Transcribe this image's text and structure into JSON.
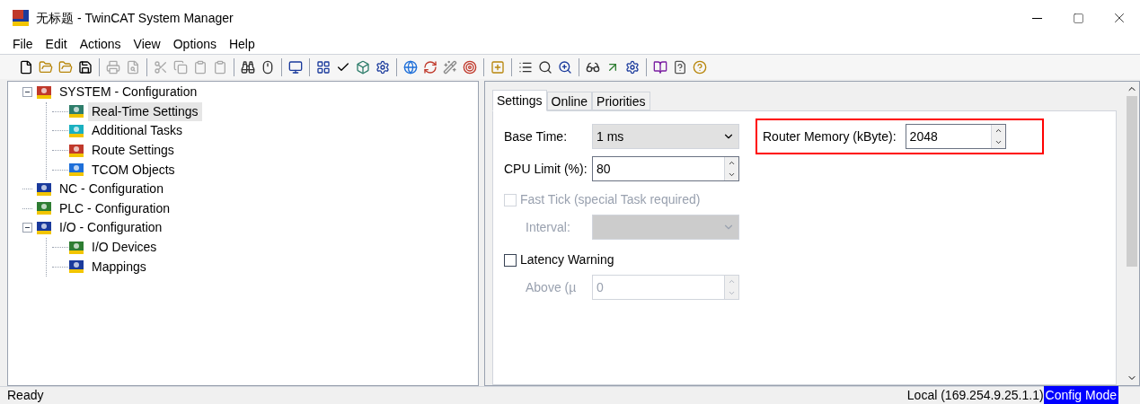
{
  "window": {
    "title": "无标题 - TwinCAT System Manager"
  },
  "menu": [
    "File",
    "Edit",
    "Actions",
    "View",
    "Options",
    "Help"
  ],
  "toolbar": [
    {
      "kind": "new",
      "disabled": false
    },
    {
      "kind": "open",
      "disabled": false
    },
    {
      "kind": "open",
      "disabled": false
    },
    {
      "kind": "save",
      "disabled": false
    },
    {
      "kind": "sep"
    },
    {
      "kind": "print",
      "disabled": true
    },
    {
      "kind": "preview",
      "disabled": true
    },
    {
      "kind": "sep"
    },
    {
      "kind": "cut",
      "disabled": true
    },
    {
      "kind": "copy",
      "disabled": true
    },
    {
      "kind": "paste",
      "disabled": true
    },
    {
      "kind": "paste",
      "disabled": true
    },
    {
      "kind": "sep"
    },
    {
      "kind": "find",
      "disabled": false
    },
    {
      "kind": "mouse",
      "disabled": false
    },
    {
      "kind": "sep"
    },
    {
      "kind": "monitor",
      "disabled": false
    },
    {
      "kind": "sep"
    },
    {
      "kind": "grid",
      "disabled": false
    },
    {
      "kind": "check",
      "disabled": false
    },
    {
      "kind": "cube",
      "disabled": false
    },
    {
      "kind": "gear",
      "disabled": false
    },
    {
      "kind": "sep"
    },
    {
      "kind": "globe",
      "disabled": false
    },
    {
      "kind": "refresh",
      "disabled": false
    },
    {
      "kind": "wand",
      "disabled": false
    },
    {
      "kind": "target",
      "disabled": false
    },
    {
      "kind": "sep"
    },
    {
      "kind": "plus",
      "disabled": false
    },
    {
      "kind": "sep"
    },
    {
      "kind": "list",
      "disabled": false
    },
    {
      "kind": "find2",
      "disabled": false
    },
    {
      "kind": "zoom",
      "disabled": false
    },
    {
      "kind": "sep"
    },
    {
      "kind": "glasses",
      "disabled": false
    },
    {
      "kind": "arrow",
      "disabled": false
    },
    {
      "kind": "gear",
      "disabled": false
    },
    {
      "kind": "sep"
    },
    {
      "kind": "book",
      "disabled": false
    },
    {
      "kind": "help",
      "disabled": false
    },
    {
      "kind": "question",
      "disabled": false
    }
  ],
  "tree": [
    {
      "label": "SYSTEM - Configuration",
      "color": "#c0392b",
      "expanded": true,
      "selected": false,
      "children": [
        {
          "label": "Real-Time Settings",
          "color": "#2e7d6b",
          "selected": true
        },
        {
          "label": "Additional Tasks",
          "color": "#1ab0c0",
          "selected": false
        },
        {
          "label": "Route Settings",
          "color": "#c0392b",
          "selected": false
        },
        {
          "label": "TCOM Objects",
          "color": "#1e6fd9",
          "selected": false
        }
      ]
    },
    {
      "label": "NC - Configuration",
      "color": "#1a3a9c",
      "selected": false
    },
    {
      "label": "PLC - Configuration",
      "color": "#2e7d32",
      "selected": false
    },
    {
      "label": "I/O - Configuration",
      "color": "#1a3a9c",
      "expanded": true,
      "selected": false,
      "children": [
        {
          "label": "I/O Devices",
          "color": "#2e7d32",
          "selected": false
        },
        {
          "label": "Mappings",
          "color": "#1a3a9c",
          "selected": false
        }
      ]
    }
  ],
  "tabs": [
    {
      "label": "Settings",
      "selected": true
    },
    {
      "label": "Online",
      "selected": false
    },
    {
      "label": "Priorities",
      "selected": false
    }
  ],
  "settings": {
    "base_time": {
      "label": "Base Time:",
      "value": "1 ms"
    },
    "cpu_limit": {
      "label": "CPU Limit (%):",
      "value": "80"
    },
    "fast_tick": {
      "label": "Fast Tick (special Task required)",
      "checked": false,
      "disabled": true
    },
    "interval": {
      "label": "Interval:",
      "disabled": true
    },
    "latency_warning": {
      "label": "Latency Warning",
      "checked": false,
      "disabled": false
    },
    "above": {
      "label": "Above (µ",
      "value": "0",
      "disabled": true
    },
    "router_memory": {
      "label": "Router Memory (kByte):",
      "value": "2048",
      "highlighted": true
    }
  },
  "status_bar": {
    "left": "Ready",
    "connection": "Local (169.254.9.25.1.1)",
    "mode": "Config Mode"
  }
}
